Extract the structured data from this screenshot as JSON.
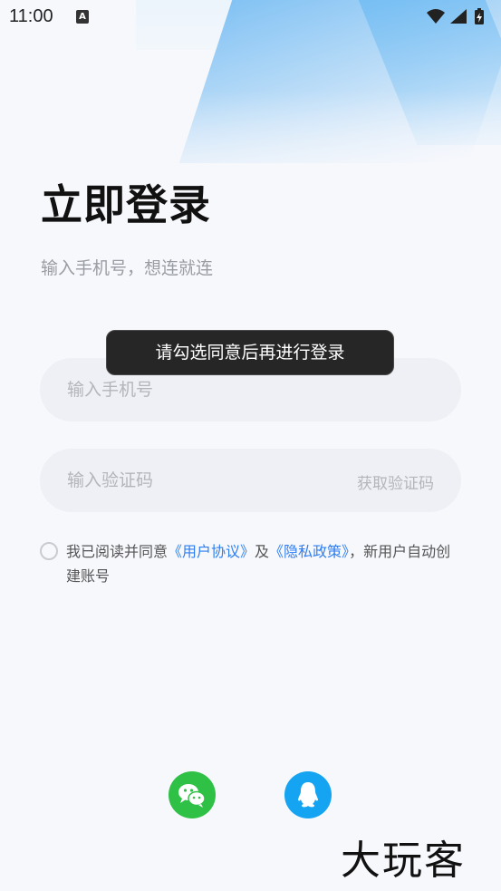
{
  "status_bar": {
    "time": "11:00",
    "notification_icon": "A"
  },
  "login": {
    "title": "立即登录",
    "subtitle": "输入手机号，想连就连",
    "phone_placeholder": "输入手机号",
    "code_placeholder": "输入验证码",
    "get_code_label": "获取验证码"
  },
  "agreement": {
    "prefix": "我已阅读并同意",
    "user_agreement": "《用户协议》",
    "and": "及",
    "privacy_policy": "《隐私政策》",
    "suffix": "，新用户自动创建账号"
  },
  "toast": {
    "message": "请勾选同意后再进行登录"
  },
  "social": {
    "wechat_icon": "wechat-icon",
    "qq_icon": "qq-icon"
  },
  "watermark": {
    "text": "大玩客"
  },
  "colors": {
    "link": "#2f7ef0",
    "wechat": "#2fc046",
    "qq": "#15a4f2",
    "background": "#f7f8fc"
  }
}
